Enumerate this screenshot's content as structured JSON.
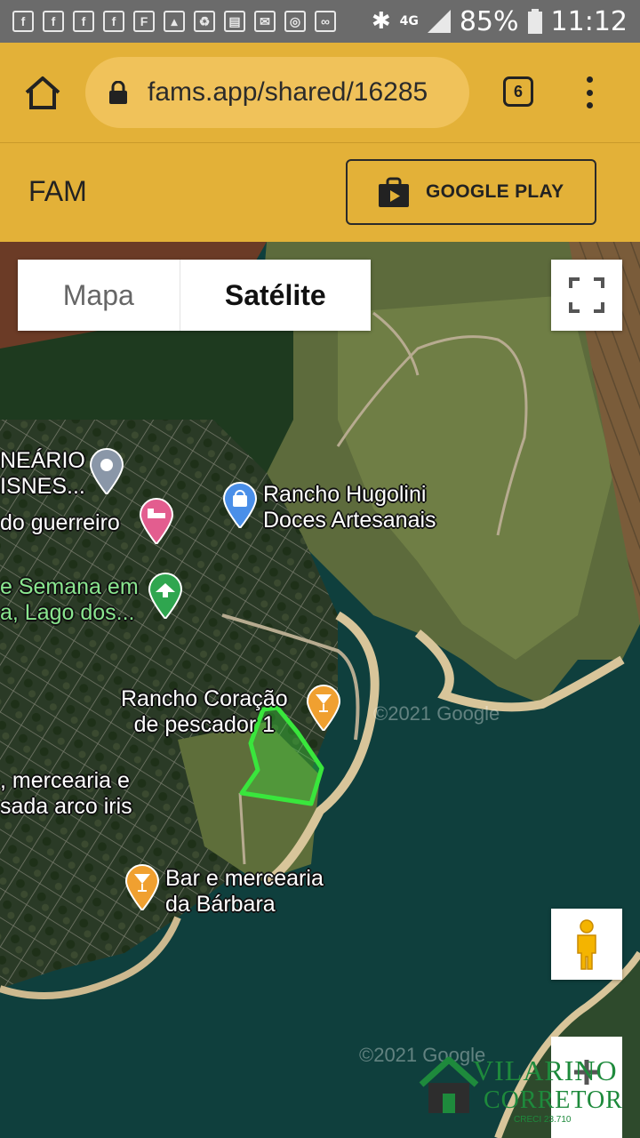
{
  "status_bar": {
    "notification_icons": [
      "facebook-icon",
      "facebook-icon",
      "facebook-icon",
      "facebook-icon",
      "flipboard-icon",
      "gallery-icon",
      "recycle-icon",
      "calendar-icon",
      "mail-icon",
      "sync-icon",
      "voicemail-icon"
    ],
    "network": "4G",
    "battery": "85%",
    "time": "11:12"
  },
  "browser": {
    "url": "fams.app/shared/16285",
    "tab_count": "6"
  },
  "app": {
    "title": "FAM",
    "store_button": "GOOGLE PLAY"
  },
  "map": {
    "type_options": [
      "Mapa",
      "Satélite"
    ],
    "selected_type": "Satélite",
    "places": [
      {
        "name_line1": "NEÁRIO",
        "name_line2": "ISNES...",
        "icon": "location-pin-icon"
      },
      {
        "name_line1": "do guerreiro",
        "name_line2": "",
        "icon": "hotel-pin-icon"
      },
      {
        "name_line1": "Rancho Hugolini",
        "name_line2": "Doces Artesanais",
        "icon": "shopping-pin-icon"
      },
      {
        "name_line1": "e Semana em",
        "name_line2": "a, Lago dos...",
        "icon": "park-pin-icon"
      },
      {
        "name_line1": "Rancho Coração",
        "name_line2": "de pescador 1",
        "icon": "bar-pin-icon"
      },
      {
        "name_line1": ", mercearia e",
        "name_line2": "sada arco iris",
        "icon": ""
      },
      {
        "name_line1": "Bar e mercearia",
        "name_line2": "da Bárbara",
        "icon": "bar-pin-icon"
      }
    ],
    "imagery_credit": "©2021 Google",
    "highlight_color": "#39e63c"
  },
  "watermark": {
    "name": "VILARINO",
    "role": "CORRETOR",
    "creci": "CRECI 23.710"
  }
}
